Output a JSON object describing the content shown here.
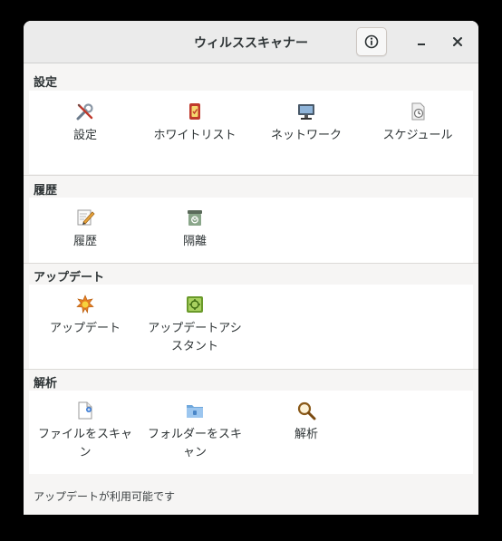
{
  "window": {
    "title": "ウィルススキャナー"
  },
  "sections": [
    {
      "header": "設定",
      "items": [
        {
          "label": "設定",
          "icon": "tools-icon"
        },
        {
          "label": "ホワイトリスト",
          "icon": "whitelist-icon"
        },
        {
          "label": "ネットワーク",
          "icon": "network-icon"
        },
        {
          "label": "スケジュール",
          "icon": "schedule-icon"
        }
      ]
    },
    {
      "header": "履歴",
      "items": [
        {
          "label": "履歴",
          "icon": "history-icon"
        },
        {
          "label": "隔離",
          "icon": "quarantine-icon"
        }
      ]
    },
    {
      "header": "アップデート",
      "items": [
        {
          "label": "アップデート",
          "icon": "update-icon"
        },
        {
          "label": "アップデートアシスタント",
          "icon": "update-assistant-icon"
        }
      ]
    },
    {
      "header": "解析",
      "items": [
        {
          "label": "ファイルをスキャン",
          "icon": "scan-file-icon"
        },
        {
          "label": "フォルダーをスキャン",
          "icon": "scan-folder-icon"
        },
        {
          "label": "解析",
          "icon": "analysis-icon"
        }
      ]
    }
  ],
  "status_bar": {
    "text": "アップデートが利用可能です"
  }
}
